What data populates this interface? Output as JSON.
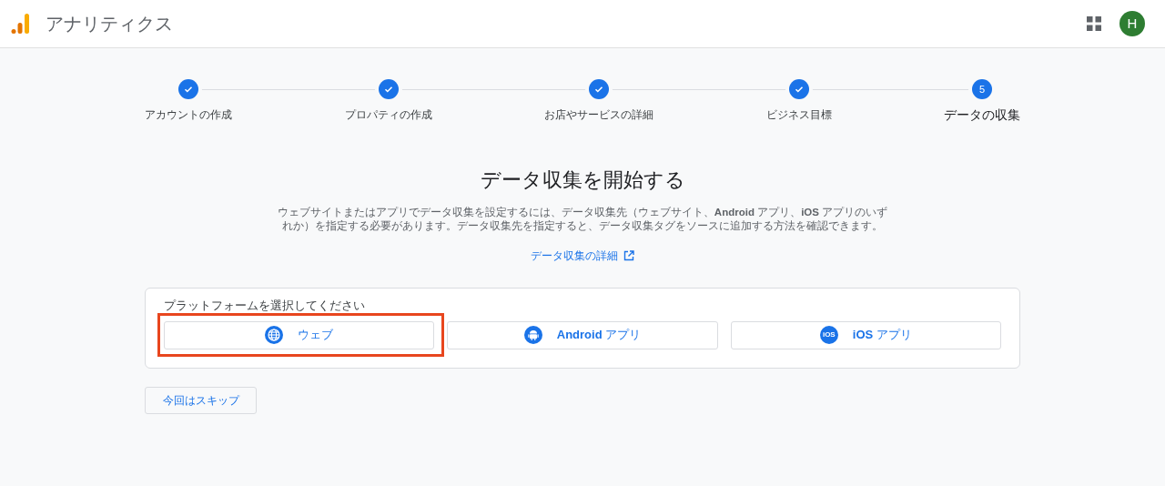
{
  "header": {
    "title": "アナリティクス",
    "avatar": "H"
  },
  "steps": [
    {
      "label": "アカウントの作成",
      "done": true
    },
    {
      "label": "プロパティの作成",
      "done": true
    },
    {
      "label": "お店やサービスの詳細",
      "done": true
    },
    {
      "label": "ビジネス目標",
      "done": true
    },
    {
      "label": "データの収集",
      "done": false,
      "number": "5"
    }
  ],
  "heading": "データ収集を開始する",
  "description": "ウェブサイトまたはアプリでデータ収集を設定するには、データ収集先（ウェブサイト、**Android** アプリ、**iOS** アプリのいずれか）を指定する必要があります。データ収集先を指定すると、データ収集タグをソースに追加する方法を確認できます。",
  "details_link": "データ収集の詳細",
  "platform_card": {
    "label": "プラットフォームを選択してください",
    "options": [
      {
        "kind": "web",
        "label": "ウェブ",
        "highlighted": true
      },
      {
        "kind": "android",
        "label": "**Android** アプリ",
        "highlighted": false
      },
      {
        "kind": "ios",
        "label": "**iOS** アプリ",
        "icon_label": "iOS",
        "highlighted": false
      }
    ]
  },
  "skip_button": "今回はスキップ"
}
